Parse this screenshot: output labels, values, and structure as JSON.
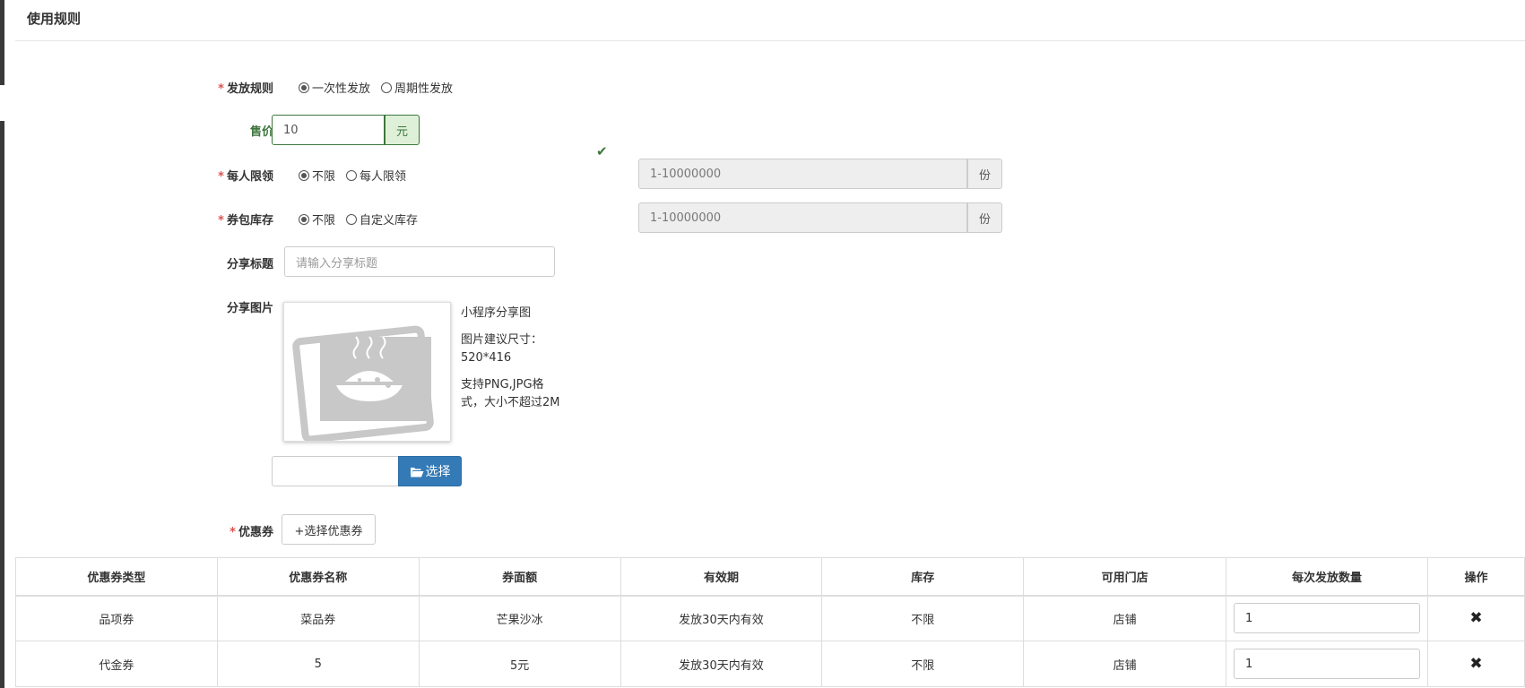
{
  "section": {
    "title": "使用规则"
  },
  "issue_rule": {
    "label": "发放规则",
    "required": "*",
    "options": [
      "一次性发放",
      "周期性发放"
    ],
    "selected": 0
  },
  "price": {
    "label": "售价",
    "value": "10",
    "unit": "元"
  },
  "per_user_limit": {
    "label": "每人限领",
    "required": "*",
    "options": [
      "不限",
      "每人限领"
    ],
    "selected": 0,
    "placeholder": "1-10000000",
    "unit": "份"
  },
  "stock": {
    "label": "券包库存",
    "required": "*",
    "options": [
      "不限",
      "自定义库存"
    ],
    "selected": 0,
    "placeholder": "1-10000000",
    "unit": "份"
  },
  "share_title": {
    "label": "分享标题",
    "placeholder": "请输入分享标题"
  },
  "share_image": {
    "label": "分享图片",
    "hint_1": "小程序分享图",
    "hint_2a": "图片建议尺寸：",
    "hint_2b": "520*416",
    "hint_3a": "支持PNG,JPG格",
    "hint_3b": "式，大小不超过2M",
    "select_button": "选择",
    "folder_icon": "folder-open-icon"
  },
  "coupons": {
    "label": "优惠券",
    "required": "*",
    "select_button": "+选择优惠券",
    "columns": [
      "优惠券类型",
      "优惠券名称",
      "券面额",
      "有效期",
      "库存",
      "可用门店",
      "每次发放数量",
      "操作"
    ],
    "rows": [
      {
        "type": "品项券",
        "name": "菜品券",
        "face_value": "芒果沙冰",
        "validity": "发放30天内有效",
        "stock": "不限",
        "store": "店铺",
        "quantity": "1"
      },
      {
        "type": "代金券",
        "name": "5",
        "face_value": "5元",
        "validity": "发放30天内有效",
        "stock": "不限",
        "store": "店铺",
        "quantity": "1"
      }
    ]
  },
  "colors": {
    "primary": "#337ab7",
    "success": "#3c763d",
    "required": "#d9534f"
  }
}
